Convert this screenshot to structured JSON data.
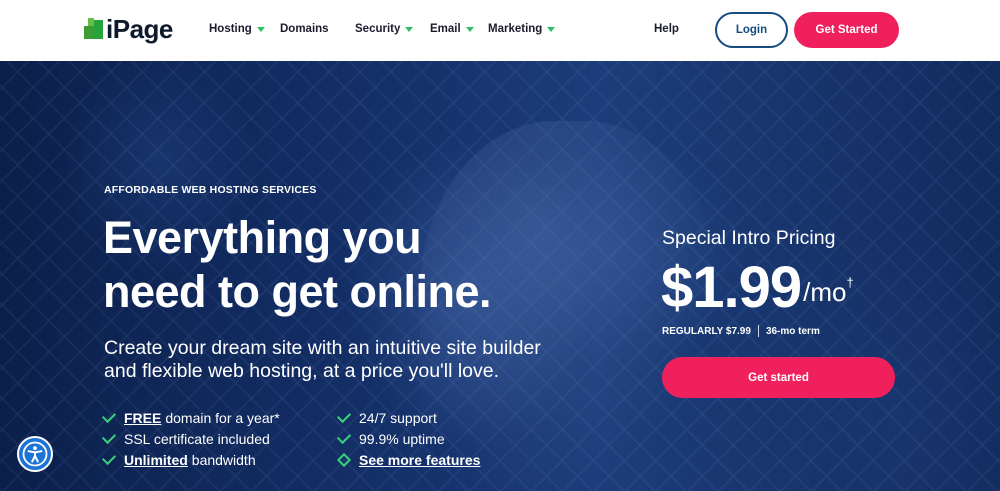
{
  "brand": {
    "name": "iPage"
  },
  "nav": {
    "items": [
      {
        "label": "Hosting",
        "has_dropdown": true
      },
      {
        "label": "Domains",
        "has_dropdown": false
      },
      {
        "label": "Security",
        "has_dropdown": true
      },
      {
        "label": "Email",
        "has_dropdown": true
      },
      {
        "label": "Marketing",
        "has_dropdown": true
      }
    ],
    "help": "Help",
    "login": "Login",
    "get_started": "Get Started"
  },
  "hero": {
    "eyebrow": "AFFORDABLE WEB HOSTING SERVICES",
    "headline_line1": "Everything you",
    "headline_line2": "need to get online.",
    "subhead": "Create your dream site with an intuitive site builder and flexible web hosting, at a price you'll love.",
    "features_left": [
      {
        "emphasis": "FREE",
        "text": "domain for a year*"
      },
      {
        "emphasis": "",
        "text": "SSL certificate included"
      },
      {
        "emphasis": "Unlimited",
        "text": "bandwidth"
      }
    ],
    "features_right": [
      {
        "text": "24/7 support"
      },
      {
        "text": "99.9% uptime"
      },
      {
        "text": "See more features"
      }
    ]
  },
  "pricing": {
    "label": "Special Intro Pricing",
    "amount": "$1.99",
    "unit": "/mo",
    "dagger": "†",
    "regular": "REGULARLY $7.99",
    "term": "36-mo term",
    "cta": "Get started"
  },
  "colors": {
    "accent": "#f0205d",
    "login_border": "#154b7e",
    "check_green": "#39d07a",
    "hero_bg": "#16336e"
  },
  "icons": {
    "accessibility": "accessibility-icon",
    "check": "check-icon",
    "caret": "chevron-down-icon"
  }
}
